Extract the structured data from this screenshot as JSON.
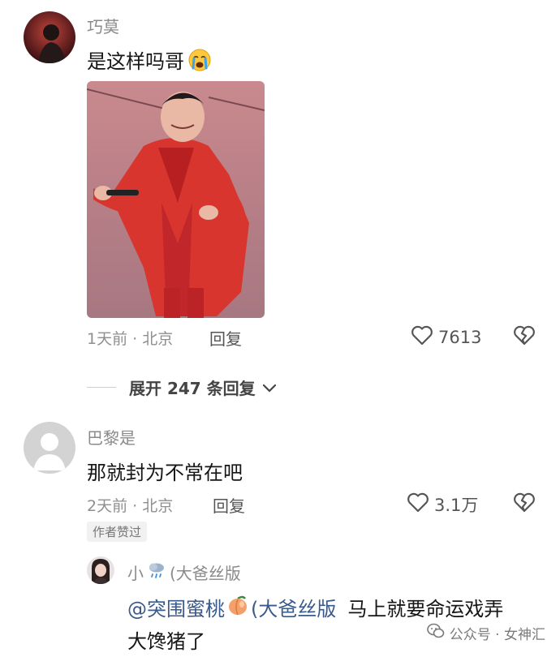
{
  "comments": [
    {
      "username": "巧莫",
      "text": "是这样吗哥",
      "emoji": "crying-face-emoji",
      "time_location": "1天前 · 北京",
      "reply_label": "回复",
      "likes": "7613",
      "expand_label": "展开 247 条回复"
    },
    {
      "username": "巴黎是",
      "text": "那就封为不常在吧",
      "time_location": "2天前 · 北京",
      "reply_label": "回复",
      "likes": "3.1万",
      "badge": "作者赞过"
    }
  ],
  "reply": {
    "username_prefix": "小",
    "username_icon": "rain-cloud-emoji",
    "username_suffix": "(大爸丝版",
    "mention_prefix": "@突围蜜桃",
    "mention_icon": "peach-emoji",
    "mention_suffix": "(大爸丝版",
    "text_line1": "马上就要命运戏弄",
    "text_line2": "大馋猪了"
  },
  "watermark": {
    "text": "公众号 · 女神汇",
    "icon": "wechat-icon"
  },
  "colors": {
    "outfit_red": "#d8352f",
    "mention_blue": "#3a5a8c"
  }
}
